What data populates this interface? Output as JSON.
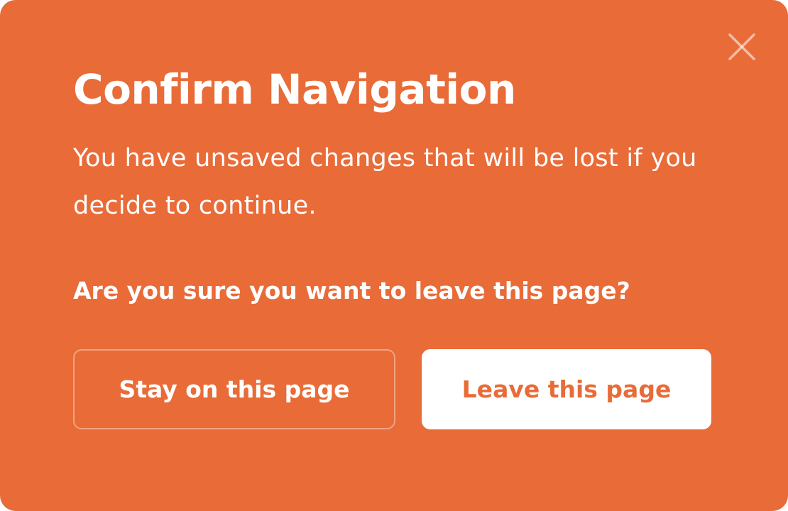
{
  "colors": {
    "dialog_background": "#e96b38",
    "text": "#ffffff",
    "primary_button_background": "#ffffff",
    "primary_button_text": "#e96b38"
  },
  "dialog": {
    "close_icon": "close-icon",
    "title": "Confirm Navigation",
    "message": "You have unsaved changes that will be lost if you decide to continue.",
    "question": "Are you sure you want to leave this page?",
    "stay_button_label": "Stay on this page",
    "leave_button_label": "Leave this page"
  }
}
